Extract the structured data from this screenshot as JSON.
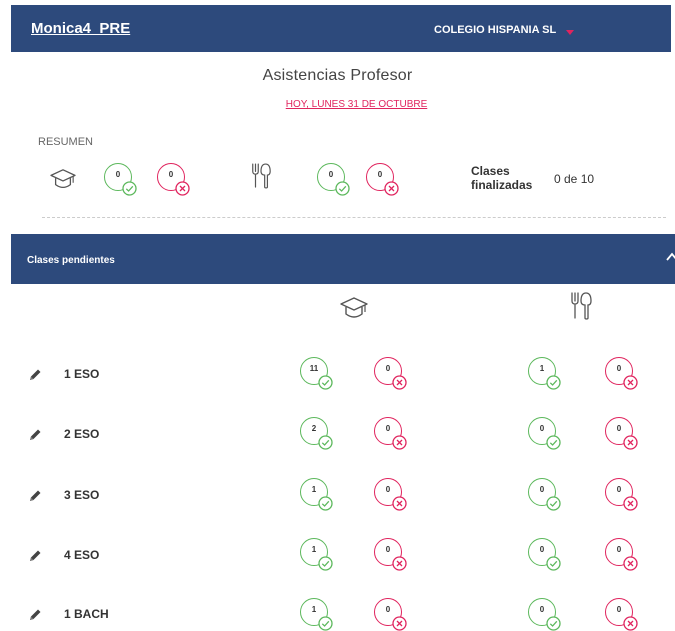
{
  "header": {
    "app_name": "Monica4_PRE",
    "organization": "COLEGIO HISPANIA SL",
    "brand_color": "#2d4a7c",
    "accent_color": "#e0245e"
  },
  "page": {
    "title": "Asistencias Profesor",
    "date_link": "HOY, LUNES 31 DE OCTUBRE"
  },
  "summary": {
    "label": "RESUMEN",
    "class_icon": "graduation-cap-icon",
    "class_present": "0",
    "class_absent": "0",
    "meal_icon": "cutlery-icon",
    "meal_present": "0",
    "meal_absent": "0",
    "finished_label": "Clases finalizadas",
    "finished_value": "0 de 10"
  },
  "pending": {
    "title": "Clases pendientes",
    "collapse_icon": "chevron-up-icon",
    "rows": [
      {
        "name": "1 ESO",
        "class_present": "11",
        "class_absent": "0",
        "meal_present": "1",
        "meal_absent": "0"
      },
      {
        "name": "2 ESO",
        "class_present": "2",
        "class_absent": "0",
        "meal_present": "0",
        "meal_absent": "0"
      },
      {
        "name": "3 ESO",
        "class_present": "1",
        "class_absent": "0",
        "meal_present": "0",
        "meal_absent": "0"
      },
      {
        "name": "4 ESO",
        "class_present": "1",
        "class_absent": "0",
        "meal_present": "0",
        "meal_absent": "0"
      },
      {
        "name": "1 BACH",
        "class_present": "1",
        "class_absent": "0",
        "meal_present": "0",
        "meal_absent": "0"
      }
    ]
  },
  "status_colors": {
    "present": "#5cb85c",
    "absent": "#e0245e"
  }
}
